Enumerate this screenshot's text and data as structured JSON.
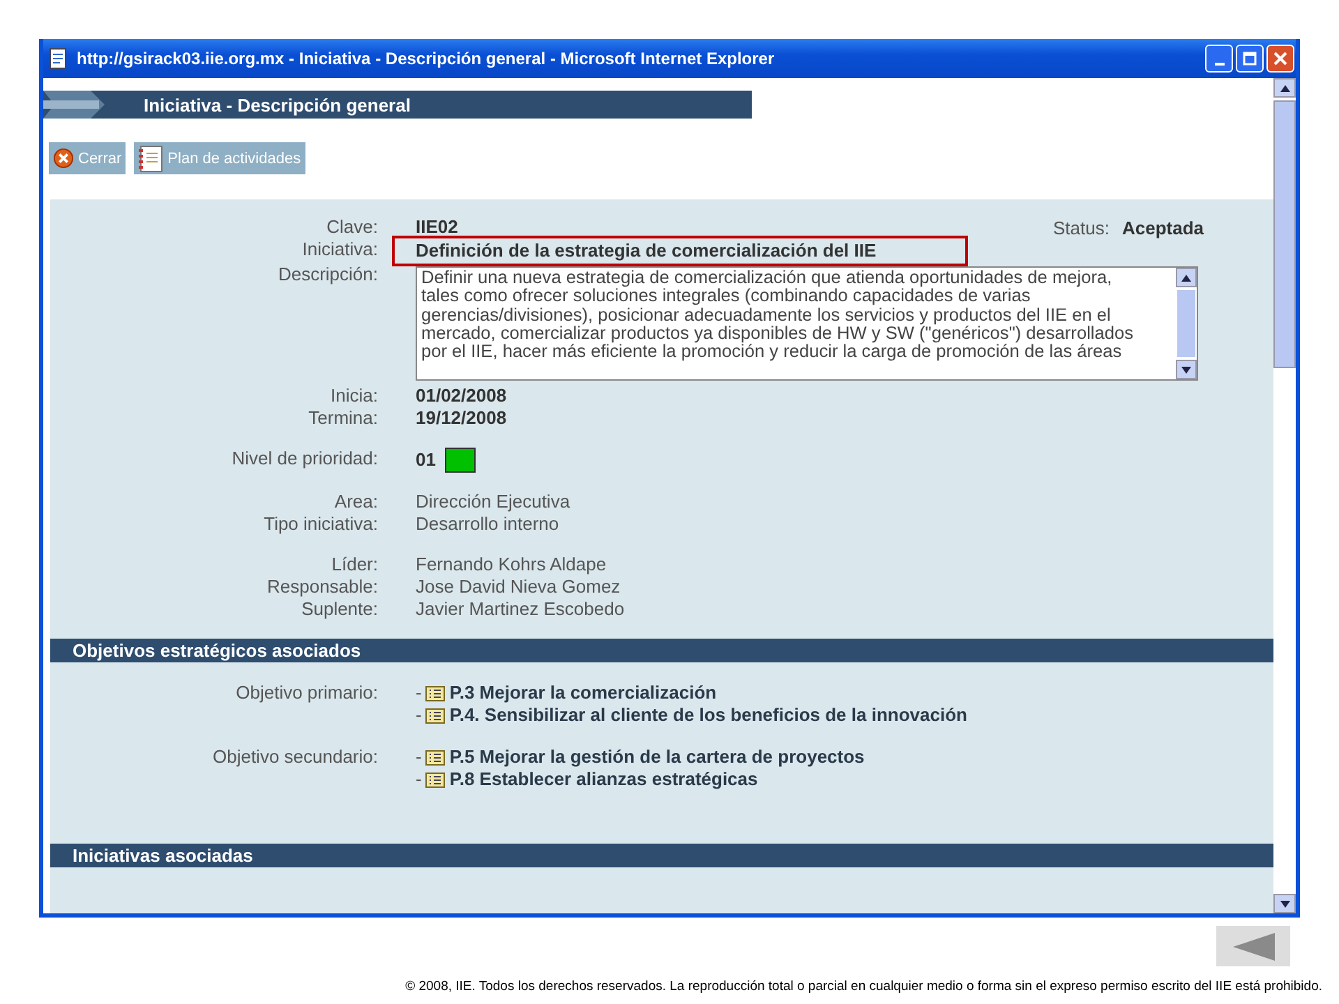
{
  "window": {
    "title": "http://gsirack03.iie.org.mx - Iniciativa - Descripción general - Microsoft Internet Explorer"
  },
  "page_title": "Iniciativa - Descripción general",
  "toolbar": [
    {
      "label": "Cerrar",
      "kind": "close"
    },
    {
      "label": "Plan de actividades",
      "kind": "plan"
    }
  ],
  "status": {
    "label": "Status:",
    "value": "Aceptada"
  },
  "field_groups": [
    [
      {
        "label": "Clave:",
        "value": "IIE02",
        "kind": "strong",
        "highlighted": false
      },
      {
        "label": "Iniciativa:",
        "value": "Definición de la estrategia de comercialización del IIE",
        "kind": "strong",
        "highlighted": true
      },
      {
        "label": "Descripción:",
        "value": "Definir una nueva estrategia de comercialización que atienda oportunidades de mejora, tales como ofrecer soluciones integrales (combinando capacidades de varias gerencias/divisiones), posicionar adecuadamente los servicios y productos del IIE en el mercado, comercializar productos ya disponibles de HW y SW (\"genéricos\") desarrollados por el IIE, hacer más eficiente la promoción y reducir la carga de promoción de las áreas",
        "kind": "textarea",
        "highlighted": false
      },
      {
        "label": "Inicia:",
        "value": "01/02/2008",
        "kind": "strong",
        "highlighted": false
      },
      {
        "label": "Termina:",
        "value": "19/12/2008",
        "kind": "strong",
        "highlighted": false
      }
    ],
    [
      {
        "label": "Nivel de prioridad:",
        "value": "01",
        "kind": "priority",
        "color": "#00c000",
        "highlighted": false
      }
    ],
    [
      {
        "label": "Area:",
        "value": "Dirección Ejecutiva",
        "kind": "text",
        "highlighted": false
      },
      {
        "label": "Tipo iniciativa:",
        "value": "Desarrollo interno",
        "kind": "text",
        "highlighted": false
      }
    ],
    [
      {
        "label": "Líder:",
        "value": "Fernando Kohrs Aldape",
        "kind": "text",
        "highlighted": false
      },
      {
        "label": "Responsable:",
        "value": "Jose David Nieva Gomez",
        "kind": "text",
        "highlighted": false
      },
      {
        "label": "Suplente:",
        "value": "Javier Martinez Escobedo",
        "kind": "text",
        "highlighted": false
      }
    ]
  ],
  "sections": [
    {
      "title": "Objetivos estratégicos asociados",
      "groups": [
        {
          "label": "Objetivo primario:",
          "items": [
            {
              "bullet": "-",
              "text": "P.3 Mejorar la comercialización"
            },
            {
              "bullet": "-",
              "text": "P.4. Sensibilizar al cliente de los beneficios de la innovación"
            }
          ]
        },
        {
          "label": "Objetivo secundario:",
          "items": [
            {
              "bullet": "-",
              "text": "P.5 Mejorar la gestión de la cartera de proyectos"
            },
            {
              "bullet": "-",
              "text": "P.8 Establecer alianzas estratégicas"
            }
          ]
        }
      ]
    },
    {
      "title": "Iniciativas asociadas"
    }
  ],
  "footer": "© 2008, IIE. Todos los derechos reservados. La reproducción total o parcial en cualquier medio o forma sin el expreso permiso escrito del IIE está prohibido."
}
